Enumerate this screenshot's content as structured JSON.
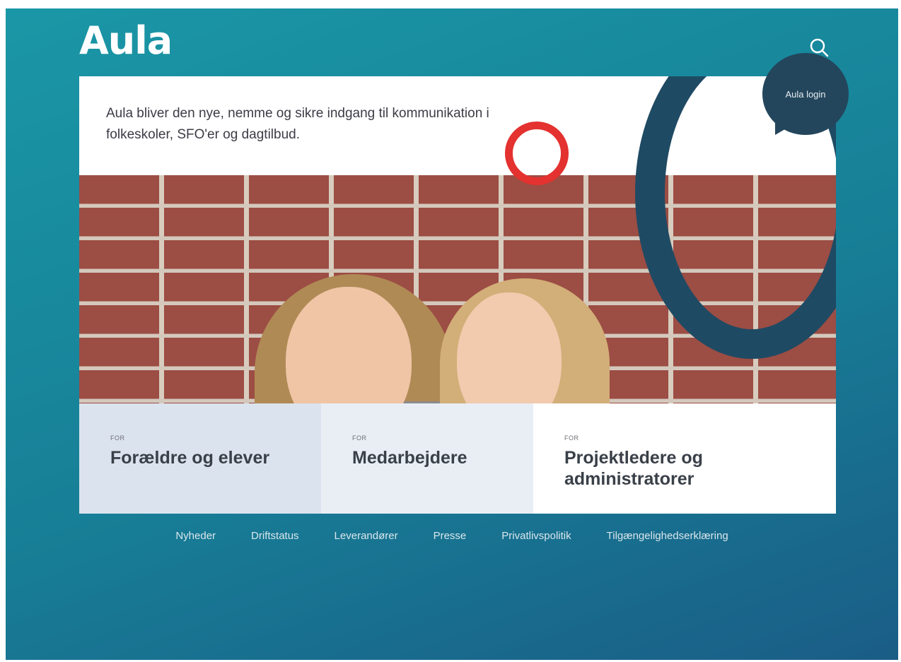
{
  "header": {
    "logo_text": "Aula",
    "search_icon": "search-icon",
    "login_label": "Aula login"
  },
  "hero": {
    "text": "Aula bliver den nye, nemme og sikre indgang til kommunikation i folkeskoler, SFO'er og dagtilbud."
  },
  "audiences": [
    {
      "prefix": "FOR",
      "title": "Forældre og elever"
    },
    {
      "prefix": "FOR",
      "title": "Medarbejdere"
    },
    {
      "prefix": "FOR",
      "title": "Projektledere og administratorer"
    }
  ],
  "footer": {
    "links": [
      "Nyheder",
      "Driftstatus",
      "Leverandører",
      "Presse",
      "Privatlivspolitik",
      "Tilgængelighedserklæring"
    ]
  },
  "colors": {
    "background": "#177f97",
    "dark_ring": "#1f4a63",
    "red_ring": "#e3322f",
    "login_bubble": "#23465c"
  }
}
